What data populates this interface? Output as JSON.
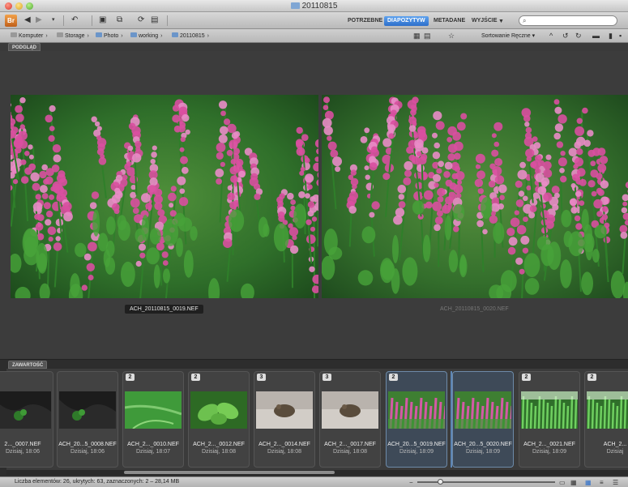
{
  "window": {
    "title": "20110815"
  },
  "toolbar": {
    "app_logo": "Br",
    "workspaces": [
      {
        "label": "POTRZEBNE",
        "active": false
      },
      {
        "label": "DIAPOZYTYW",
        "active": true
      },
      {
        "label": "METADANE",
        "active": false
      },
      {
        "label": "WYJŚCIE",
        "active": false
      }
    ],
    "search_placeholder": "",
    "search_icon_glyph": "⌕"
  },
  "pathbar": {
    "crumbs": [
      "Komputer",
      "Storage",
      "Photo",
      "working",
      "20110815"
    ],
    "sort_label": "Sortowanie Ręczne ▾"
  },
  "preview": {
    "panel_tab": "PODGLĄD",
    "left_caption": "ACH_20110815_0019.NEF",
    "right_caption": "ACH_20110815_0020.NEF"
  },
  "content": {
    "panel_tab": "ZAWARTOŚĆ",
    "thumbs": [
      {
        "badge": "",
        "name": "2..._0007.NEF",
        "date": "Dzisiaj, 18:06",
        "kind": "dark"
      },
      {
        "badge": "",
        "name": "ACH_20...5_0008.NEF",
        "date": "Dzisiaj, 18:06",
        "kind": "dark"
      },
      {
        "badge": "2",
        "name": "ACH_2..._0010.NEF",
        "date": "Dzisiaj, 18:07",
        "kind": "grass"
      },
      {
        "badge": "2",
        "name": "ACH_2..._0012.NEF",
        "date": "Dzisiaj, 18:08",
        "kind": "leaf"
      },
      {
        "badge": "3",
        "name": "ACH_2..._0014.NEF",
        "date": "Dzisiaj, 18:08",
        "kind": "frog"
      },
      {
        "badge": "3",
        "name": "ACH_2..._0017.NEF",
        "date": "Dzisiaj, 18:08",
        "kind": "frog"
      },
      {
        "badge": "2",
        "name": "ACH_20...5_0019.NEF",
        "date": "Dzisiaj, 18:09",
        "kind": "heather",
        "selected": true
      },
      {
        "badge": "",
        "name": "ACH_20...5_0020.NEF",
        "date": "Dzisiaj, 18:09",
        "kind": "heather",
        "selected": true
      },
      {
        "badge": "2",
        "name": "ACH_2..._0021.NEF",
        "date": "Dzisiaj, 18:09",
        "kind": "green"
      },
      {
        "badge": "2",
        "name": "ACH_2...",
        "date": "Dzisiaj",
        "kind": "green"
      }
    ]
  },
  "statusbar": {
    "text": "Liczba elementów: 26, ukrytych: 63, zaznaczonych: 2 – 28,14 MB"
  }
}
